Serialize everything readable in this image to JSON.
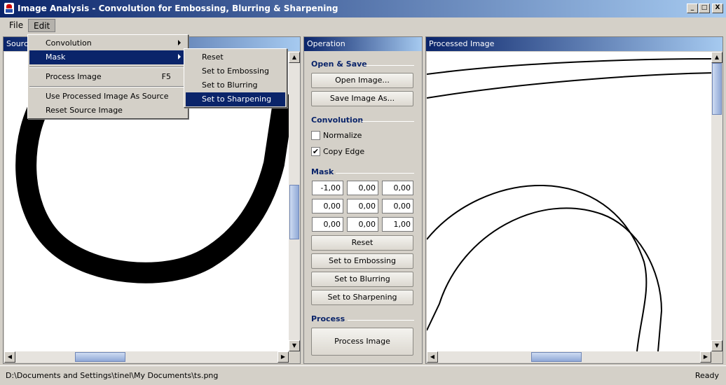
{
  "window": {
    "title": "Image Analysis - Convolution for Embossing, Blurring & Sharpening",
    "buttons": [
      "_",
      "□",
      "X"
    ]
  },
  "menubar": {
    "file": "File",
    "edit": "Edit"
  },
  "edit_menu": {
    "items": [
      {
        "label": "Convolution",
        "submenu": true
      },
      {
        "label": "Mask",
        "submenu": true,
        "highlighted": true
      },
      {
        "label": "Process Image",
        "shortcut": "F5"
      },
      {
        "label": "Use Processed Image As Source"
      },
      {
        "label": "Reset Source Image"
      }
    ]
  },
  "mask_menu": {
    "items": [
      {
        "label": "Reset"
      },
      {
        "label": "Set to Embossing"
      },
      {
        "label": "Set to Blurring"
      },
      {
        "label": "Set to Sharpening",
        "highlighted": true
      }
    ]
  },
  "source_panel": {
    "title": "Source"
  },
  "operation_panel": {
    "title": "Operation",
    "open_save": {
      "heading": "Open & Save",
      "open_button": "Open Image...",
      "save_button": "Save Image As..."
    },
    "convolution": {
      "heading": "Convolution",
      "normalize_label": "Normalize",
      "normalize_checked": false,
      "copy_edge_label": "Copy Edge",
      "copy_edge_checked": true
    },
    "mask": {
      "heading": "Mask",
      "values": [
        "-1,00",
        "0,00",
        "0,00",
        "0,00",
        "0,00",
        "0,00",
        "0,00",
        "0,00",
        "1,00"
      ],
      "reset_button": "Reset",
      "embossing_button": "Set to Embossing",
      "blurring_button": "Set to Blurring",
      "sharpening_button": "Set to Sharpening"
    },
    "process": {
      "heading": "Process",
      "process_button": "Process Image"
    }
  },
  "processed_panel": {
    "title": "Processed Image"
  },
  "statusbar": {
    "path": "D:\\Documents and Settings\\tinel\\My Documents\\ts.png",
    "status": "Ready"
  },
  "colors": {
    "titlebar": "#0a246a",
    "accent": "#a6caf0",
    "selection": "#0a246a"
  }
}
